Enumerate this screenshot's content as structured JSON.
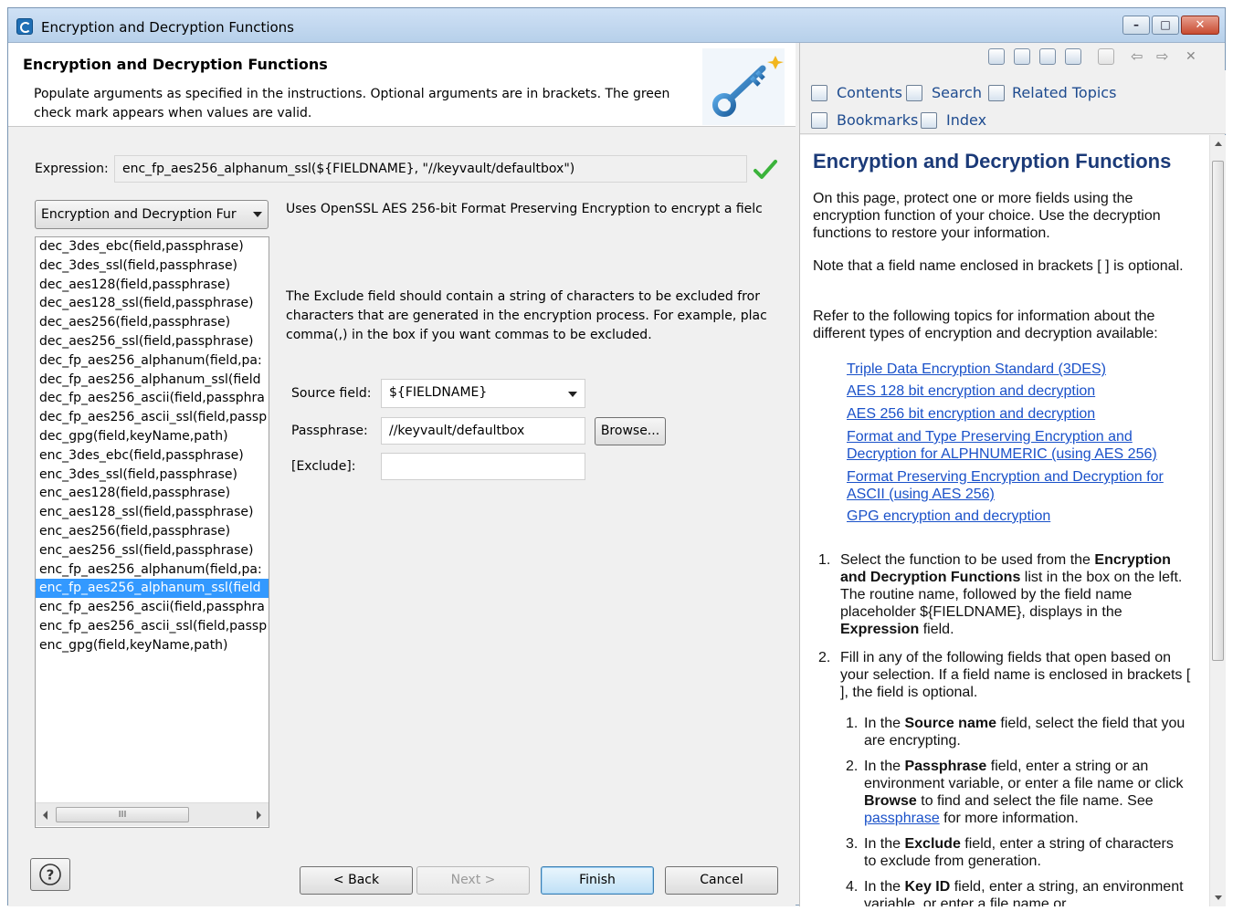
{
  "window": {
    "title": "Encryption and Decryption Functions"
  },
  "wizard": {
    "title": "Encryption and Decryption Functions",
    "description": "Populate arguments as specified in the instructions. Optional arguments are in brackets. The green check mark appears when values are valid.",
    "expression_label": "Expression:",
    "expression_value": "enc_fp_aes256_alphanum_ssl(${FIELDNAME}, \"//keyvault/defaultbox\")",
    "category_selected": "Encryption and Decryption Fur",
    "functions": [
      "dec_3des_ebc(field,passphrase)",
      "dec_3des_ssl(field,passphrase)",
      "dec_aes128(field,passphrase)",
      "dec_aes128_ssl(field,passphrase)",
      "dec_aes256(field,passphrase)",
      "dec_aes256_ssl(field,passphrase)",
      "dec_fp_aes256_alphanum(field,pa:",
      "dec_fp_aes256_alphanum_ssl(field",
      "dec_fp_aes256_ascii(field,passphra",
      "dec_fp_aes256_ascii_ssl(field,passp",
      "dec_gpg(field,keyName,path)",
      "enc_3des_ebc(field,passphrase)",
      "enc_3des_ssl(field,passphrase)",
      "enc_aes128(field,passphrase)",
      "enc_aes128_ssl(field,passphrase)",
      "enc_aes256(field,passphrase)",
      "enc_aes256_ssl(field,passphrase)",
      "enc_fp_aes256_alphanum(field,pa:",
      "enc_fp_aes256_alphanum_ssl(field",
      "enc_fp_aes256_ascii(field,passphra",
      "enc_fp_aes256_ascii_ssl(field,passp",
      "enc_gpg(field,keyName,path)"
    ],
    "selected_function": "enc_fp_aes256_alphanum_ssl(field",
    "func_description": "Uses OpenSSL AES 256-bit Format Preserving Encryption to encrypt a fielc",
    "exclude_description": "The Exclude field should contain a string of characters to be excluded fror\ncharacters that are generated in the encryption process. For example, plac\ncomma(,) in the box if you want commas to be excluded.",
    "source_field_label": "Source field:",
    "source_field_value": "${FIELDNAME}",
    "passphrase_label": "Passphrase:",
    "passphrase_value": "//keyvault/defaultbox",
    "browse_label": "Browse...",
    "exclude_label": "[Exclude]:",
    "exclude_value": "",
    "scroll_thumb": "III",
    "buttons": {
      "back": "< Back",
      "next": "Next >",
      "finish": "Finish",
      "cancel": "Cancel"
    }
  },
  "help": {
    "nav": {
      "contents": "Contents",
      "search": "Search",
      "related": "Related Topics",
      "bookmarks": "Bookmarks",
      "index": "Index"
    },
    "title": "Encryption and Decryption Functions",
    "para1": "On this page, protect one or more fields using the encryption function of your choice. Use the decryption functions to restore your information.",
    "para2": "Note that a field name enclosed in brackets [ ] is optional.",
    "para3": "Refer to the following topics for information about the different types of encryption and decryption available:",
    "links": [
      "Triple Data Encryption Standard (3DES)",
      "AES 128 bit encryption and decryption",
      "AES 256 bit encryption and decryption",
      "Format and Type Preserving Encryption and Decryption for ALPHNUMERIC (using AES 256)",
      "Format Preserving Encryption and Decryption for ASCII (using AES 256)",
      "GPG encryption and decryption"
    ],
    "steps": {
      "s1_num": "1.",
      "s1_a": "Select the function to be used from the ",
      "s1_b": "Encryption and Decryption Functions",
      "s1_c": " list in the box on the left. The routine name, followed by the field name placeholder ${FIELDNAME}, displays in the ",
      "s1_d": "Expression",
      "s1_e": " field.",
      "s2_num": "2.",
      "s2": "Fill in any of the following fields that open based on your selection. If a field name is enclosed in brackets [ ], the field is optional.",
      "ss1_num": "1.",
      "ss1_a": "In the ",
      "ss1_b": "Source name",
      "ss1_c": " field, select the field that you are encrypting.",
      "ss2_num": "2.",
      "ss2_a": "In the ",
      "ss2_b": "Passphrase",
      "ss2_c": " field, enter a string or an environment variable, or enter a file name or click ",
      "ss2_d": "Browse",
      "ss2_e": " to find and select the file name. See ",
      "ss2_link": "passphrase",
      "ss2_f": " for more information.",
      "ss3_num": "3.",
      "ss3_a": "In the ",
      "ss3_b": "Exclude",
      "ss3_c": " field, enter a string of characters to exclude from generation.",
      "ss4_num": "4.",
      "ss4_a": "In the ",
      "ss4_b": "Key ID",
      "ss4_c": " field, enter a string, an environment variable, or enter a file name or"
    }
  },
  "colors": {
    "selection": "#3399ff",
    "link": "#1a51c9",
    "help_title": "#1b3a78",
    "check": "#3bb33b"
  }
}
